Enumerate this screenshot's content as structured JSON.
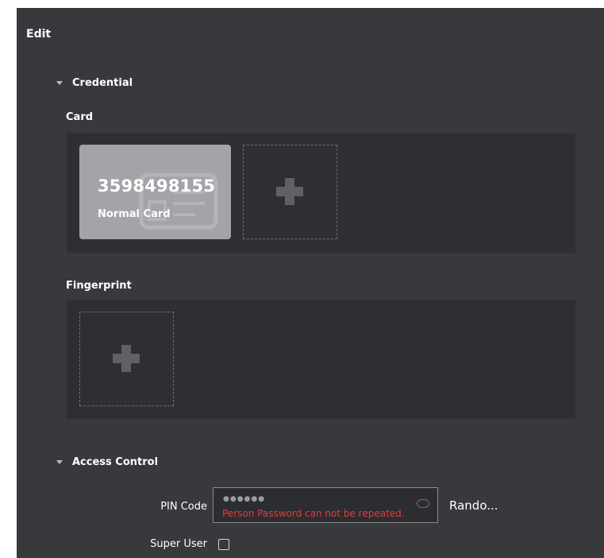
{
  "title": "Edit",
  "credential": {
    "section_label": "Credential",
    "card": {
      "label": "Card",
      "number": "3598498155",
      "type": "Normal Card"
    },
    "fingerprint": {
      "label": "Fingerprint"
    }
  },
  "access_control": {
    "section_label": "Access Control",
    "pin_code": {
      "label": "PIN Code",
      "masked_value": "●●●●●●",
      "error": "Person Password can not be repeated."
    },
    "random_label": "Rando...",
    "super_user": {
      "label": "Super User",
      "checked": false
    }
  },
  "colors": {
    "panel_bg": "#37393d",
    "box_bg": "#2d2f32",
    "card_bg": "#a2a4a8",
    "error": "#e23b3b"
  },
  "icons": [
    "chevron-down-icon",
    "id-card-icon",
    "plus-icon",
    "eye-icon",
    "checkbox-icon"
  ]
}
